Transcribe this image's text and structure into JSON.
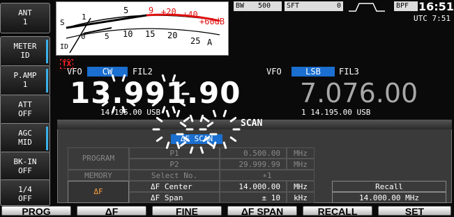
{
  "side_buttons": [
    {
      "l1": "ANT",
      "l2": "1"
    },
    {
      "l1": "METER",
      "l2": "ID"
    },
    {
      "l1": "P.AMP",
      "l2": "1"
    },
    {
      "l1": "ATT",
      "l2": "OFF"
    },
    {
      "l1": "AGC",
      "l2": "MID"
    },
    {
      "l1": "BK-IN",
      "l2": "OFF"
    },
    {
      "l1": "1/4",
      "l2": "OFF"
    }
  ],
  "meter": {
    "scale_top": [
      "S",
      "1",
      "5",
      "9",
      "+20",
      "+40",
      "+60dB"
    ],
    "scale_bottom": [
      "0",
      "5",
      "10",
      "15",
      "20",
      "25",
      "A"
    ],
    "id_label": "ID"
  },
  "top": {
    "bw_label": "BW",
    "bw_value": "500",
    "sft_label": "SFT",
    "sft_value": "0",
    "bpf": "BPF",
    "time": "16:51",
    "utc": "UTC 7:51"
  },
  "tx": "TX",
  "left_vfo": {
    "vfo": "VFO",
    "mode": "CW",
    "fil": "FIL2",
    "freq": "13.991.90",
    "sub": "14.195.00 USB"
  },
  "right_vfo": {
    "vfo": "VFO",
    "mode": "LSB",
    "fil": "FIL3",
    "freq": "7.076.00",
    "sub": "1 14.195.00 USB"
  },
  "scan": {
    "title": "SCAN",
    "df_scan": "ΔF SCAN",
    "program": "PROGRAM",
    "memory": "MEMORY",
    "df": "ΔF",
    "p1": "P1",
    "p2": "P2",
    "select": "Select No.",
    "df_center": "ΔF Center",
    "df_span": "ΔF Span",
    "v_p1": "0.500.00",
    "v_p2": "29.999.99",
    "v_sel": "∗1",
    "v_center": "14.000.00",
    "v_span": "± 10",
    "u_mhz": "MHz",
    "u_khz": "kHz",
    "recall": "Recall",
    "recall_val": "14.000.00 MHz"
  },
  "bottom": [
    "PROG",
    "ΔF",
    "FINE",
    "ΔF SPAN",
    "RECALL",
    "SET"
  ],
  "colors": {
    "accent": "#1a6fd0",
    "tx": "#ff2020"
  }
}
